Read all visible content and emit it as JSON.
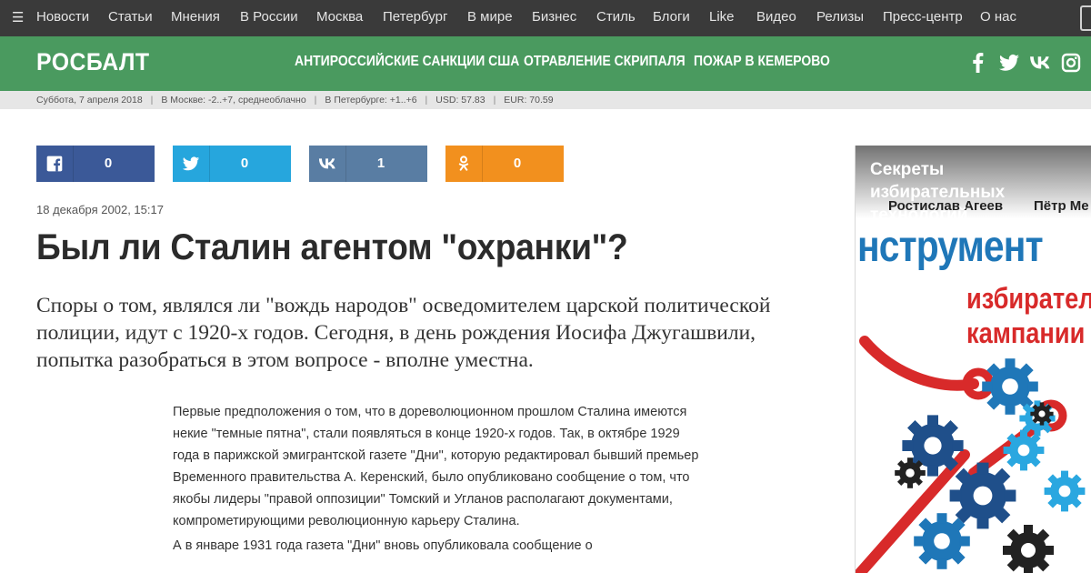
{
  "nav": {
    "items": [
      "Новости",
      "Статьи",
      "Мнения",
      "В России",
      "Москва",
      "Петербург",
      "В мире",
      "Бизнес",
      "Стиль",
      "Блоги",
      "Like",
      "Видео",
      "Релизы",
      "Пресс-центр",
      "О нас"
    ]
  },
  "header": {
    "logo": "РОСБАЛТ",
    "hot_links": [
      "АНТИРОССИЙСКИЕ САНКЦИИ США",
      "ОТРАВЛЕНИЕ СКРИПАЛЯ",
      "ПОЖАР В КЕМЕРОВО"
    ],
    "social_icons": [
      "facebook-icon",
      "twitter-icon",
      "vk-icon",
      "instagram-icon"
    ]
  },
  "infobar": {
    "date": "Суббота, 7 апреля 2018",
    "weather_msk": "В Москве: -2..+7, среднеоблачно",
    "weather_spb": "В Петербурге: +1..+6",
    "usd": "USD: 57.83",
    "eur": "EUR: 70.59",
    "separator": "|"
  },
  "share": {
    "facebook": "0",
    "twitter": "0",
    "vk": "1",
    "ok": "0",
    "colors": {
      "facebook": "#3b5998",
      "twitter": "#26a6dd",
      "vk": "#597da3",
      "ok": "#f2901e"
    }
  },
  "article": {
    "date": "18 декабря 2002, 15:17",
    "title": "Был ли Сталин агентом \"охранки\"?",
    "lead": "Споры о том, являлся ли \"вождь народов\" осведомителем царской политической полиции, идут с 1920-х годов. Сегодня, в день рождения Иосифа Джугашвили, попытка разобраться в этом вопросе - вполне уместна.",
    "paragraphs": [
      "Первые предположения о том, что в дореволюционном прошлом Сталина имеются некие \"темные пятна\", стали появляться в конце 1920-х годов. Так, в октябре 1929 года в парижской эмигрантской газете \"Дни\", которую редактировал бывший премьер Временного правительства А. Керенский, было опубликовано сообщение о том, что якобы лидеры \"правой оппозиции\" Томский и Угланов располагают документами, компрометирующими революционную карьеру Сталина.",
      "А в январе 1931 года газета \"Дни\" вновь опубликовала сообщение о"
    ]
  },
  "ad": {
    "caption": "Секреты избирательных технологий",
    "authors": [
      "Ростислав Агеев",
      "Пётр Ме"
    ],
    "word1": "нструмент",
    "word2": "избирател",
    "word3": "кампании"
  },
  "colors": {
    "topnav_bg": "#3a3a3a",
    "header_bg": "#4a9a5f",
    "infobar_bg": "#e6e6e6"
  }
}
